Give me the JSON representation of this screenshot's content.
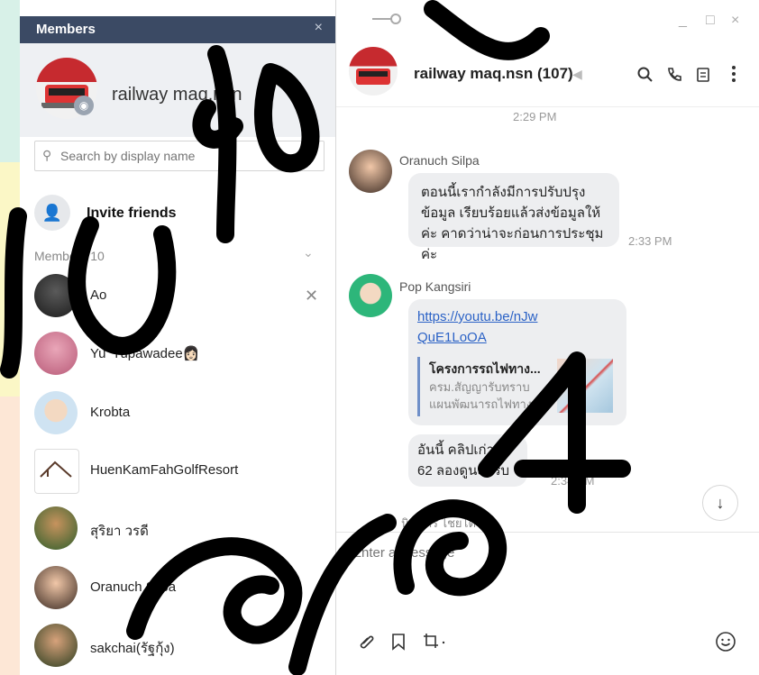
{
  "members_panel": {
    "title": "Members",
    "close": "×",
    "group_name": "railway maq.nsn",
    "search_placeholder": "Search by display name",
    "invite_label": "Invite friends",
    "members_count_label": "Members 10",
    "members": [
      {
        "name": "Ao"
      },
      {
        "name": "Yu' Yupawadee👩🏻"
      },
      {
        "name": "Krobta"
      },
      {
        "name": "HuenKamFahGolfResort"
      },
      {
        "name": "สุริยา วรดี"
      },
      {
        "name": "Oranuch Silpa"
      },
      {
        "name": "sakchai(รัฐกุ้ง)"
      }
    ]
  },
  "chat": {
    "title": "railway maq.nsn (107)",
    "window_controls": [
      "_",
      "□",
      "×"
    ],
    "top_time": "2:29 PM",
    "messages": [
      {
        "sender": "Oranuch Silpa",
        "text": "ตอนนี้เรากำลังมีการปรับปรุงข้อมูล เรียบร้อยแล้วส่งข้อมูลให้ค่ะ คาดว่าน่าจะก่อนการประชุมค่ะ",
        "time": "2:33 PM"
      },
      {
        "sender": "Pop Kangsiri",
        "link": "https://youtu.be/nJwQuE1LoOA",
        "preview_title": "โครงการรถไฟทาง...",
        "preview_desc": "ครม.สัญญารับทราบแผนพัฒนารถไฟทาง...",
        "time": ""
      },
      {
        "sender": "",
        "text": "อันนี้ คลิปเก่า ปี 62 ลองดูนะครับ",
        "time": "2:34 PM"
      }
    ],
    "typing_text": "นิธิภัทร ไชยโต",
    "composer_placeholder": "Enter a message",
    "icons": {
      "search": "search-icon",
      "call": "phone-icon",
      "notes": "notes-icon",
      "more": "more-icon"
    }
  }
}
